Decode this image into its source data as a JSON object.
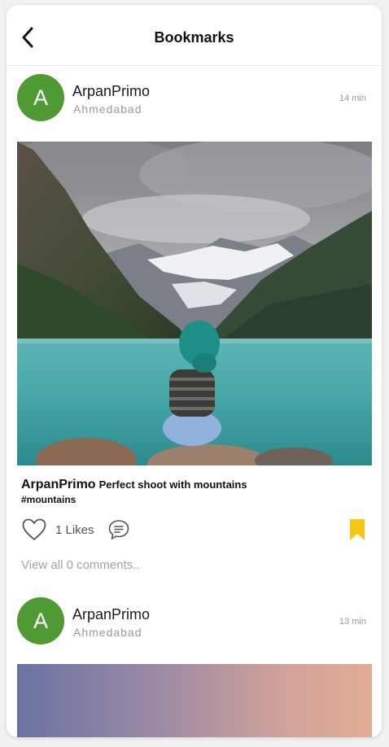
{
  "header": {
    "title": "Bookmarks",
    "back_icon": "chevron-left-icon"
  },
  "posts": [
    {
      "avatar_letter": "A",
      "username": "ArpanPrimo",
      "location": "Ahmedabad",
      "time": "14 min",
      "caption_user": "ArpanPrimo",
      "caption": "Perfect shoot with mountains",
      "hashtag": "#mountains",
      "likes": "1 Likes",
      "view_comments": "View all 0 comments..",
      "bookmarked": true
    },
    {
      "avatar_letter": "A",
      "username": "ArpanPrimo",
      "location": "Ahmedabad",
      "time": "13 min"
    }
  ],
  "colors": {
    "avatar": "#4f9a32",
    "bookmark": "#f5c518",
    "text_muted": "#9a9a9a"
  },
  "icons": {
    "like": "heart-outline-icon",
    "comment": "speech-bubble-icon",
    "bookmark": "bookmark-filled-icon"
  }
}
